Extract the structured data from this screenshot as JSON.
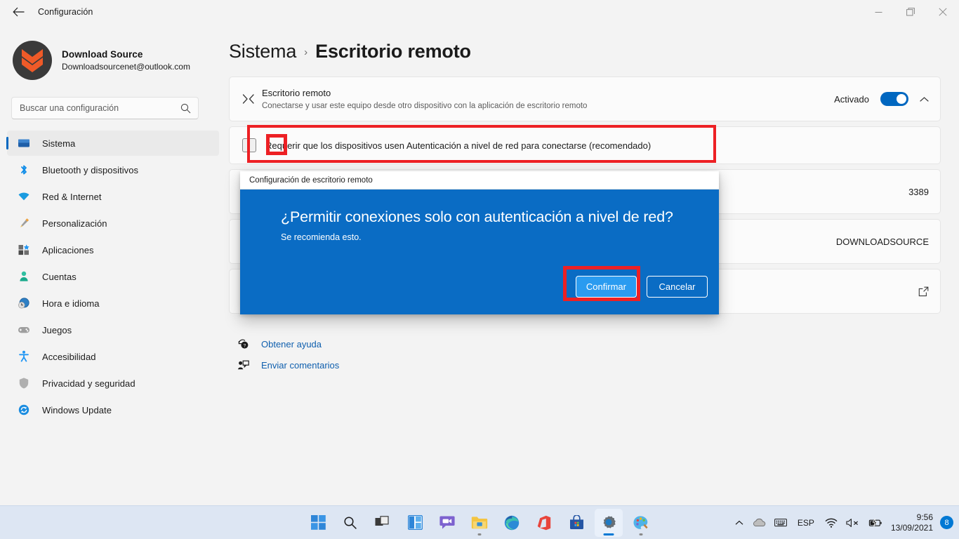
{
  "window": {
    "title": "Configuración",
    "back_icon": "back-arrow-icon",
    "minimize_label": "Minimizar",
    "maximize_label": "Maximizar",
    "close_label": "Cerrar"
  },
  "profile": {
    "name": "Download Source",
    "email": "Downloadsourcenet@outlook.com"
  },
  "search": {
    "placeholder": "Buscar una configuración",
    "value": "",
    "icon": "search-icon"
  },
  "sidebar": {
    "items": [
      {
        "label": "Sistema",
        "icon": "monitor-icon",
        "selected": true
      },
      {
        "label": "Bluetooth y dispositivos",
        "icon": "bluetooth-icon",
        "selected": false
      },
      {
        "label": "Red & Internet",
        "icon": "wifi-icon",
        "selected": false
      },
      {
        "label": "Personalización",
        "icon": "paintbrush-icon",
        "selected": false
      },
      {
        "label": "Aplicaciones",
        "icon": "apps-icon",
        "selected": false
      },
      {
        "label": "Cuentas",
        "icon": "person-icon",
        "selected": false
      },
      {
        "label": "Hora e idioma",
        "icon": "clock-globe-icon",
        "selected": false
      },
      {
        "label": "Juegos",
        "icon": "gamepad-icon",
        "selected": false
      },
      {
        "label": "Accesibilidad",
        "icon": "accessibility-icon",
        "selected": false
      },
      {
        "label": "Privacidad y seguridad",
        "icon": "shield-icon",
        "selected": false
      },
      {
        "label": "Windows Update",
        "icon": "update-icon",
        "selected": false
      }
    ]
  },
  "breadcrumb": {
    "root": "Sistema",
    "separator": "›",
    "current": "Escritorio remoto"
  },
  "remote_desktop": {
    "icon": "remote-desktop-icon",
    "title": "Escritorio remoto",
    "subtitle": "Conectarse y usar este equipo desde otro dispositivo con la aplicación de escritorio remoto",
    "state_label": "Activado",
    "toggle_on": true,
    "expand_icon": "chevron-up-icon",
    "nla_checkbox_label": "Requerir que los dispositivos usen Autenticación a nivel de red para conectarse (recomendado)",
    "nla_checked": false,
    "port_value": "3389",
    "pc_name_value": "DOWNLOADSOURCE",
    "external_link_icon": "open-external-icon"
  },
  "links": [
    {
      "label": "Obtener ayuda",
      "icon": "help-icon"
    },
    {
      "label": "Enviar comentarios",
      "icon": "feedback-icon"
    }
  ],
  "dialog": {
    "title": "Configuración de escritorio remoto",
    "heading": "¿Permitir conexiones solo con autenticación a nivel de red?",
    "body": "Se recomienda esto.",
    "confirm_label": "Confirmar",
    "cancel_label": "Cancelar"
  },
  "highlight_color": "#ED2024",
  "accent_color": "#0067C0",
  "taskbar": {
    "items": [
      {
        "name": "start",
        "label": "Inicio",
        "running": false,
        "active": false
      },
      {
        "name": "search",
        "label": "Buscar",
        "running": false,
        "active": false
      },
      {
        "name": "task-view",
        "label": "Vista de tareas",
        "running": false,
        "active": false
      },
      {
        "name": "widgets",
        "label": "Widgets",
        "running": false,
        "active": false
      },
      {
        "name": "chat",
        "label": "Chat",
        "running": false,
        "active": false
      },
      {
        "name": "file-explorer",
        "label": "Explorador de archivos",
        "running": true,
        "active": false
      },
      {
        "name": "edge",
        "label": "Microsoft Edge",
        "running": false,
        "active": false
      },
      {
        "name": "office",
        "label": "Office",
        "running": false,
        "active": false
      },
      {
        "name": "store",
        "label": "Microsoft Store",
        "running": false,
        "active": false
      },
      {
        "name": "settings",
        "label": "Configuración",
        "running": true,
        "active": true
      },
      {
        "name": "paint",
        "label": "Paint",
        "running": true,
        "active": false
      }
    ],
    "tray": {
      "overflow_icon": "chevron-up-icon",
      "cloud_icon": "onedrive-icon",
      "keyboard_icon": "keyboard-icon",
      "language": "ESP",
      "wifi_icon": "wifi-icon",
      "volume_icon": "volume-muted-icon",
      "battery_icon": "battery-charging-icon",
      "time": "9:56",
      "date": "13/09/2021",
      "notification_count": "8"
    }
  }
}
